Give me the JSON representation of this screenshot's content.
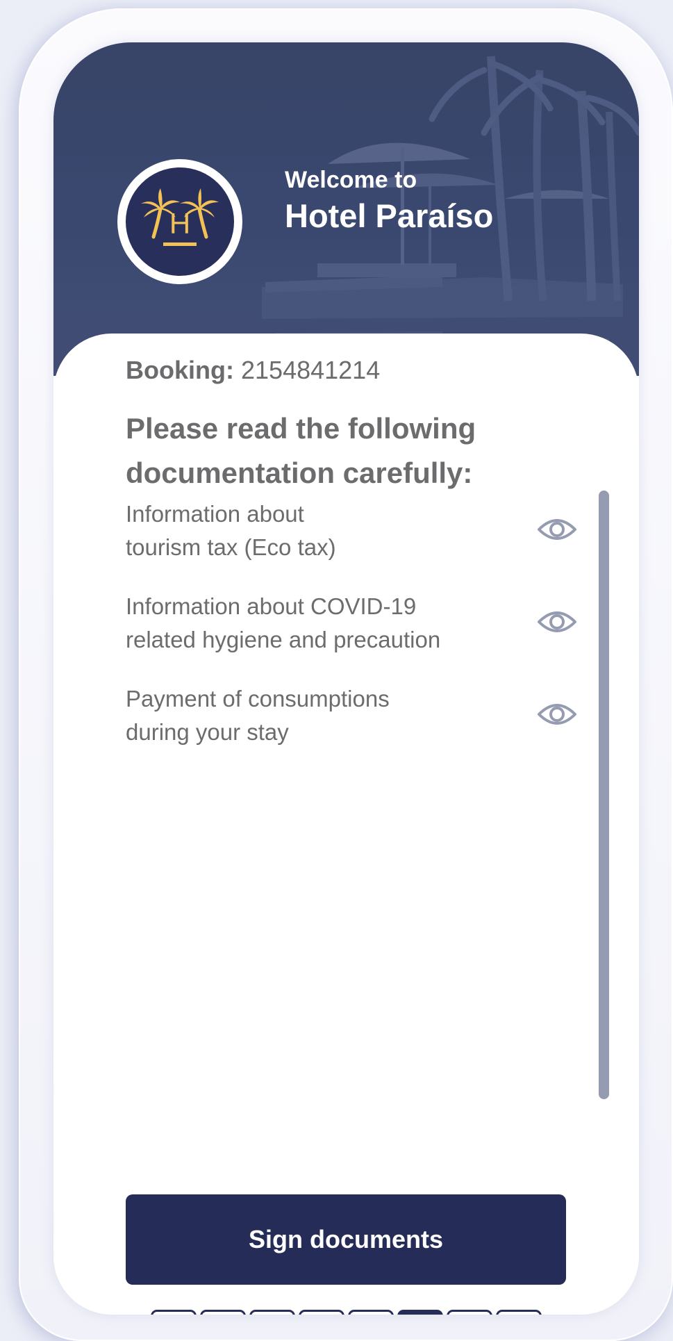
{
  "header": {
    "welcome": "Welcome to",
    "hotel_name": "Hotel Paraíso",
    "logo": {
      "icon": "palm-trees-logo-icon",
      "letter": "H",
      "accent_color": "#f4c155",
      "background_color": "#272f5a"
    }
  },
  "booking": {
    "label": "Booking:",
    "number": "2154841214"
  },
  "documents": {
    "title": "Please read the following documentation carefully:",
    "items": [
      {
        "lines": [
          "Information about",
          "tourism tax (Eco tax)"
        ],
        "icon": "eye-icon"
      },
      {
        "lines": [
          "Information about COVID-19",
          "related hygiene and precaution"
        ],
        "icon": "eye-icon"
      },
      {
        "lines": [
          "Payment of consumptions",
          "during your stay"
        ],
        "icon": "eye-icon"
      }
    ]
  },
  "actions": {
    "sign_label": "Sign documents"
  },
  "progress": {
    "total_steps": 8,
    "current_step": 6
  },
  "colors": {
    "primary": "#252c58",
    "hero": "#3a4870",
    "text": "#6c6c6e",
    "icon": "#959bb1",
    "accent": "#f4c155"
  }
}
